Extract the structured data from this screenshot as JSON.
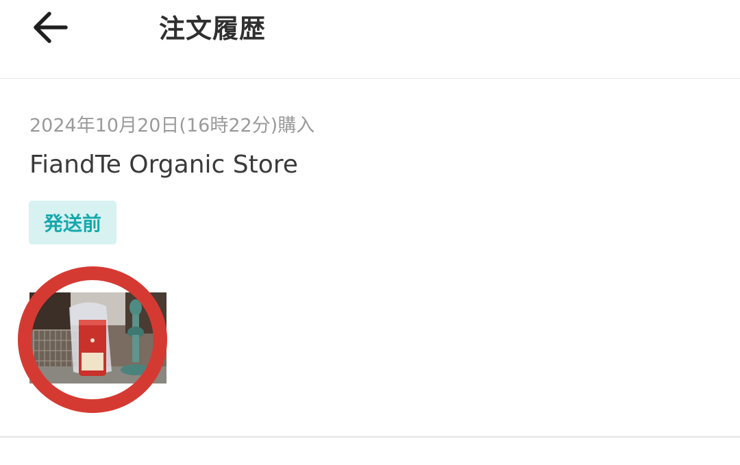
{
  "header": {
    "title": "注文履歴",
    "back_icon": "arrow-left-icon"
  },
  "order": {
    "purchase_date": "2024年10月20日(16時22分)購入",
    "store_name": "FiandTe Organic Store",
    "status": "発送前",
    "status_colors": {
      "text": "#17a8ac",
      "background": "#d7f2f1"
    }
  },
  "annotation": {
    "circle_color": "#d53a32"
  }
}
